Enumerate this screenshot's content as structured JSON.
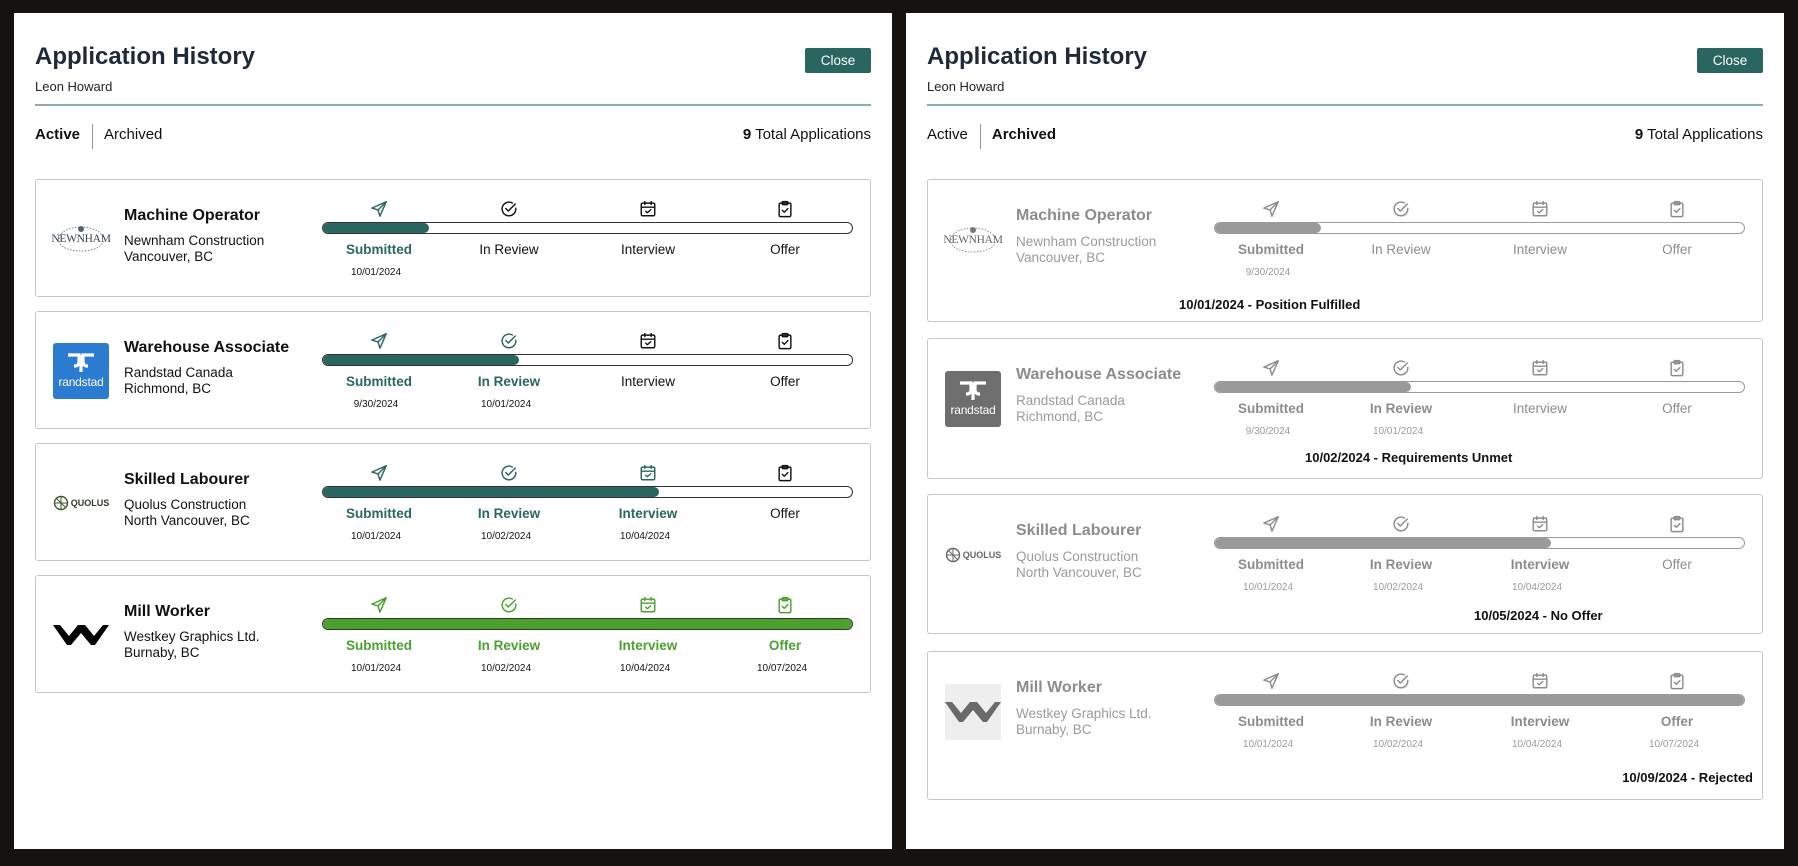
{
  "colors": {
    "teal": "#2a6660",
    "green": "#4aa12e",
    "muted_fill": "#9a9a9a",
    "muted_text": "#8c8c8c",
    "dark_text": "#111111"
  },
  "stage_icons": [
    "send-icon",
    "check-circle-icon",
    "calendar-check-icon",
    "clipboard-check-icon"
  ],
  "panels": [
    {
      "title": "Application History",
      "user": "Leon Howard",
      "close_label": "Close",
      "tabs": [
        "Active",
        "Archived"
      ],
      "active_tab": "Active",
      "total_count": "9",
      "total_label": "Total Applications",
      "applications": [
        {
          "title": "Machine Operator",
          "company": "Newnham Construction",
          "location": "Vancouver, BC",
          "logo": "newnham-logo",
          "logo_text": "NEWNHAM",
          "progress_fraction": 0.2,
          "stages": [
            {
              "label": "Submitted",
              "date": "10/01/2024",
              "done": true
            },
            {
              "label": "In Review",
              "date": "",
              "done": false
            },
            {
              "label": "Interview",
              "date": "",
              "done": false
            },
            {
              "label": "Offer",
              "date": "",
              "done": false
            }
          ],
          "outcome": ""
        },
        {
          "title": "Warehouse Associate",
          "company": "Randstad Canada",
          "location": "Richmond, BC",
          "logo": "randstad-logo",
          "logo_text": "randstad",
          "progress_fraction": 0.37,
          "stages": [
            {
              "label": "Submitted",
              "date": "9/30/2024",
              "done": true
            },
            {
              "label": "In Review",
              "date": "10/01/2024",
              "done": true
            },
            {
              "label": "Interview",
              "date": "",
              "done": false
            },
            {
              "label": "Offer",
              "date": "",
              "done": false
            }
          ],
          "outcome": ""
        },
        {
          "title": "Skilled Labourer",
          "company": "Quolus Construction",
          "location": "North Vancouver, BC",
          "logo": "quolus-logo",
          "logo_text": "QUOLUS",
          "progress_fraction": 0.635,
          "stages": [
            {
              "label": "Submitted",
              "date": "10/01/2024",
              "done": true
            },
            {
              "label": "In Review",
              "date": "10/02/2024",
              "done": true
            },
            {
              "label": "Interview",
              "date": "10/04/2024",
              "done": true
            },
            {
              "label": "Offer",
              "date": "",
              "done": false
            }
          ],
          "outcome": ""
        },
        {
          "title": "Mill Worker",
          "company": "Westkey Graphics Ltd.",
          "location": "Burnaby, BC",
          "logo": "westkey-logo",
          "logo_text": "",
          "progress_fraction": 1.0,
          "complete": true,
          "stages": [
            {
              "label": "Submitted",
              "date": "10/01/2024",
              "done": true
            },
            {
              "label": "In Review",
              "date": "10/02/2024",
              "done": true
            },
            {
              "label": "Interview",
              "date": "10/04/2024",
              "done": true
            },
            {
              "label": "Offer",
              "date": "10/07/2024",
              "done": true
            }
          ],
          "outcome": ""
        }
      ]
    },
    {
      "title": "Application History",
      "user": "Leon Howard",
      "close_label": "Close",
      "tabs": [
        "Active",
        "Archived"
      ],
      "active_tab": "Archived",
      "total_count": "9",
      "total_label": "Total Applications",
      "applications": [
        {
          "title": "Machine Operator",
          "company": "Newnham Construction",
          "location": "Vancouver, BC",
          "logo": "newnham-logo",
          "logo_text": "NEWNHAM",
          "progress_fraction": 0.2,
          "stages": [
            {
              "label": "Submitted",
              "date": "9/30/2024",
              "done": true
            },
            {
              "label": "In Review",
              "date": "",
              "done": false
            },
            {
              "label": "Interview",
              "date": "",
              "done": false
            },
            {
              "label": "Offer",
              "date": "",
              "done": false
            }
          ],
          "outcome": "10/01/2024 - Position Fulfilled"
        },
        {
          "title": "Warehouse Associate",
          "company": "Randstad Canada",
          "location": "Richmond, BC",
          "logo": "randstad-logo",
          "logo_text": "randstad",
          "progress_fraction": 0.37,
          "stages": [
            {
              "label": "Submitted",
              "date": "9/30/2024",
              "done": true
            },
            {
              "label": "In Review",
              "date": "10/01/2024",
              "done": true
            },
            {
              "label": "Interview",
              "date": "",
              "done": false
            },
            {
              "label": "Offer",
              "date": "",
              "done": false
            }
          ],
          "outcome": "10/02/2024 - Requirements Unmet"
        },
        {
          "title": "Skilled Labourer",
          "company": "Quolus Construction",
          "location": "North Vancouver, BC",
          "logo": "quolus-logo",
          "logo_text": "QUOLUS",
          "progress_fraction": 0.635,
          "stages": [
            {
              "label": "Submitted",
              "date": "10/01/2024",
              "done": true
            },
            {
              "label": "In Review",
              "date": "10/02/2024",
              "done": true
            },
            {
              "label": "Interview",
              "date": "10/04/2024",
              "done": true
            },
            {
              "label": "Offer",
              "date": "",
              "done": false
            }
          ],
          "outcome": "10/05/2024 - No Offer"
        },
        {
          "title": "Mill Worker",
          "company": "Westkey Graphics Ltd.",
          "location": "Burnaby, BC",
          "logo": "westkey-logo",
          "logo_text": "",
          "progress_fraction": 1.0,
          "stages": [
            {
              "label": "Submitted",
              "date": "10/01/2024",
              "done": true
            },
            {
              "label": "In Review",
              "date": "10/02/2024",
              "done": true
            },
            {
              "label": "Interview",
              "date": "10/04/2024",
              "done": true
            },
            {
              "label": "Offer",
              "date": "10/07/2024",
              "done": true
            }
          ],
          "outcome": "10/09/2024 - Rejected"
        }
      ]
    }
  ]
}
